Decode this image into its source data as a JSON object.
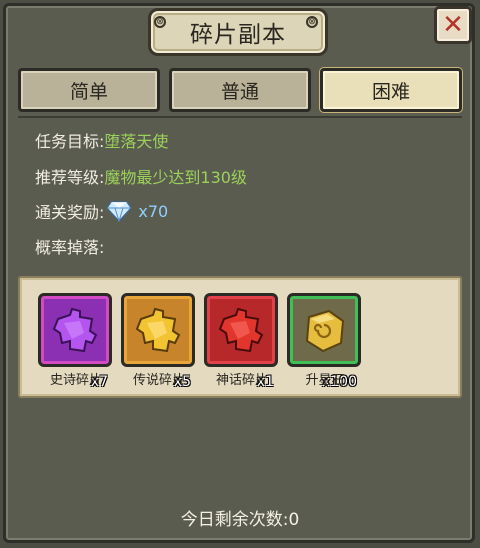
{
  "window": {
    "title": "碎片副本"
  },
  "tabs": [
    {
      "label": "简单",
      "active": false
    },
    {
      "label": "普通",
      "active": false
    },
    {
      "label": "困难",
      "active": true
    }
  ],
  "info": {
    "target_label": "任务目标:",
    "target_value": "堕落天使",
    "level_label": "推荐等级:",
    "level_value": "魔物最少达到130级",
    "reward_label": "通关奖励:",
    "reward_icon": "diamond-icon",
    "reward_value": "x70",
    "drop_label": "概率掉落:"
  },
  "drops": [
    {
      "name": "史诗碎片",
      "count": "x7",
      "icon": "purple-puzzle-fragment-icon",
      "color": "#a23fd8",
      "border": "#d34bc3"
    },
    {
      "name": "传说碎片",
      "count": "x5",
      "icon": "gold-puzzle-fragment-icon",
      "color": "#e6b02a",
      "border": "#d9921f"
    },
    {
      "name": "神话碎片",
      "count": "x1",
      "icon": "red-puzzle-fragment-icon",
      "color": "#d6322b",
      "border": "#d8323a"
    },
    {
      "name": "升星石",
      "count": "x100",
      "icon": "star-stone-icon",
      "color": "#e0b83a",
      "border": "#35b04a"
    }
  ],
  "footer": {
    "label": "今日剩余次数:0"
  }
}
